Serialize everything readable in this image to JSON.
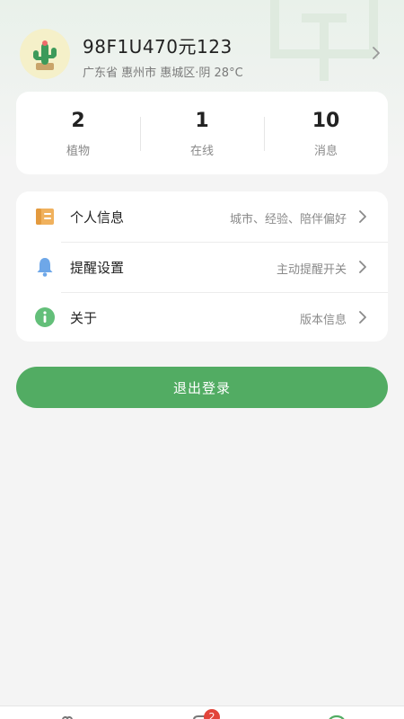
{
  "profile": {
    "name": "98F1U470元123",
    "location": "广东省 惠州市 惠城区·阴 28°C",
    "avatar_icon": "cactus-icon"
  },
  "stats": [
    {
      "value": "2",
      "label": "植物"
    },
    {
      "value": "1",
      "label": "在线"
    },
    {
      "value": "10",
      "label": "消息"
    }
  ],
  "menu": [
    {
      "icon": "notebook-icon",
      "label": "个人信息",
      "hint": "城市、经验、陪伴偏好"
    },
    {
      "icon": "bell-icon",
      "label": "提醒设置",
      "hint": "主动提醒开关"
    },
    {
      "icon": "info-icon",
      "label": "关于",
      "hint": "版本信息"
    }
  ],
  "logout_label": "退出登录",
  "tabbar": {
    "items": [
      {
        "icon": "plant-tab-icon"
      },
      {
        "icon": "chat-tab-icon",
        "badge": "2"
      },
      {
        "icon": "profile-tab-icon"
      }
    ]
  },
  "colors": {
    "accent": "#52ac63",
    "badge": "#e2443a",
    "page_bg": "#f4f4f4"
  }
}
